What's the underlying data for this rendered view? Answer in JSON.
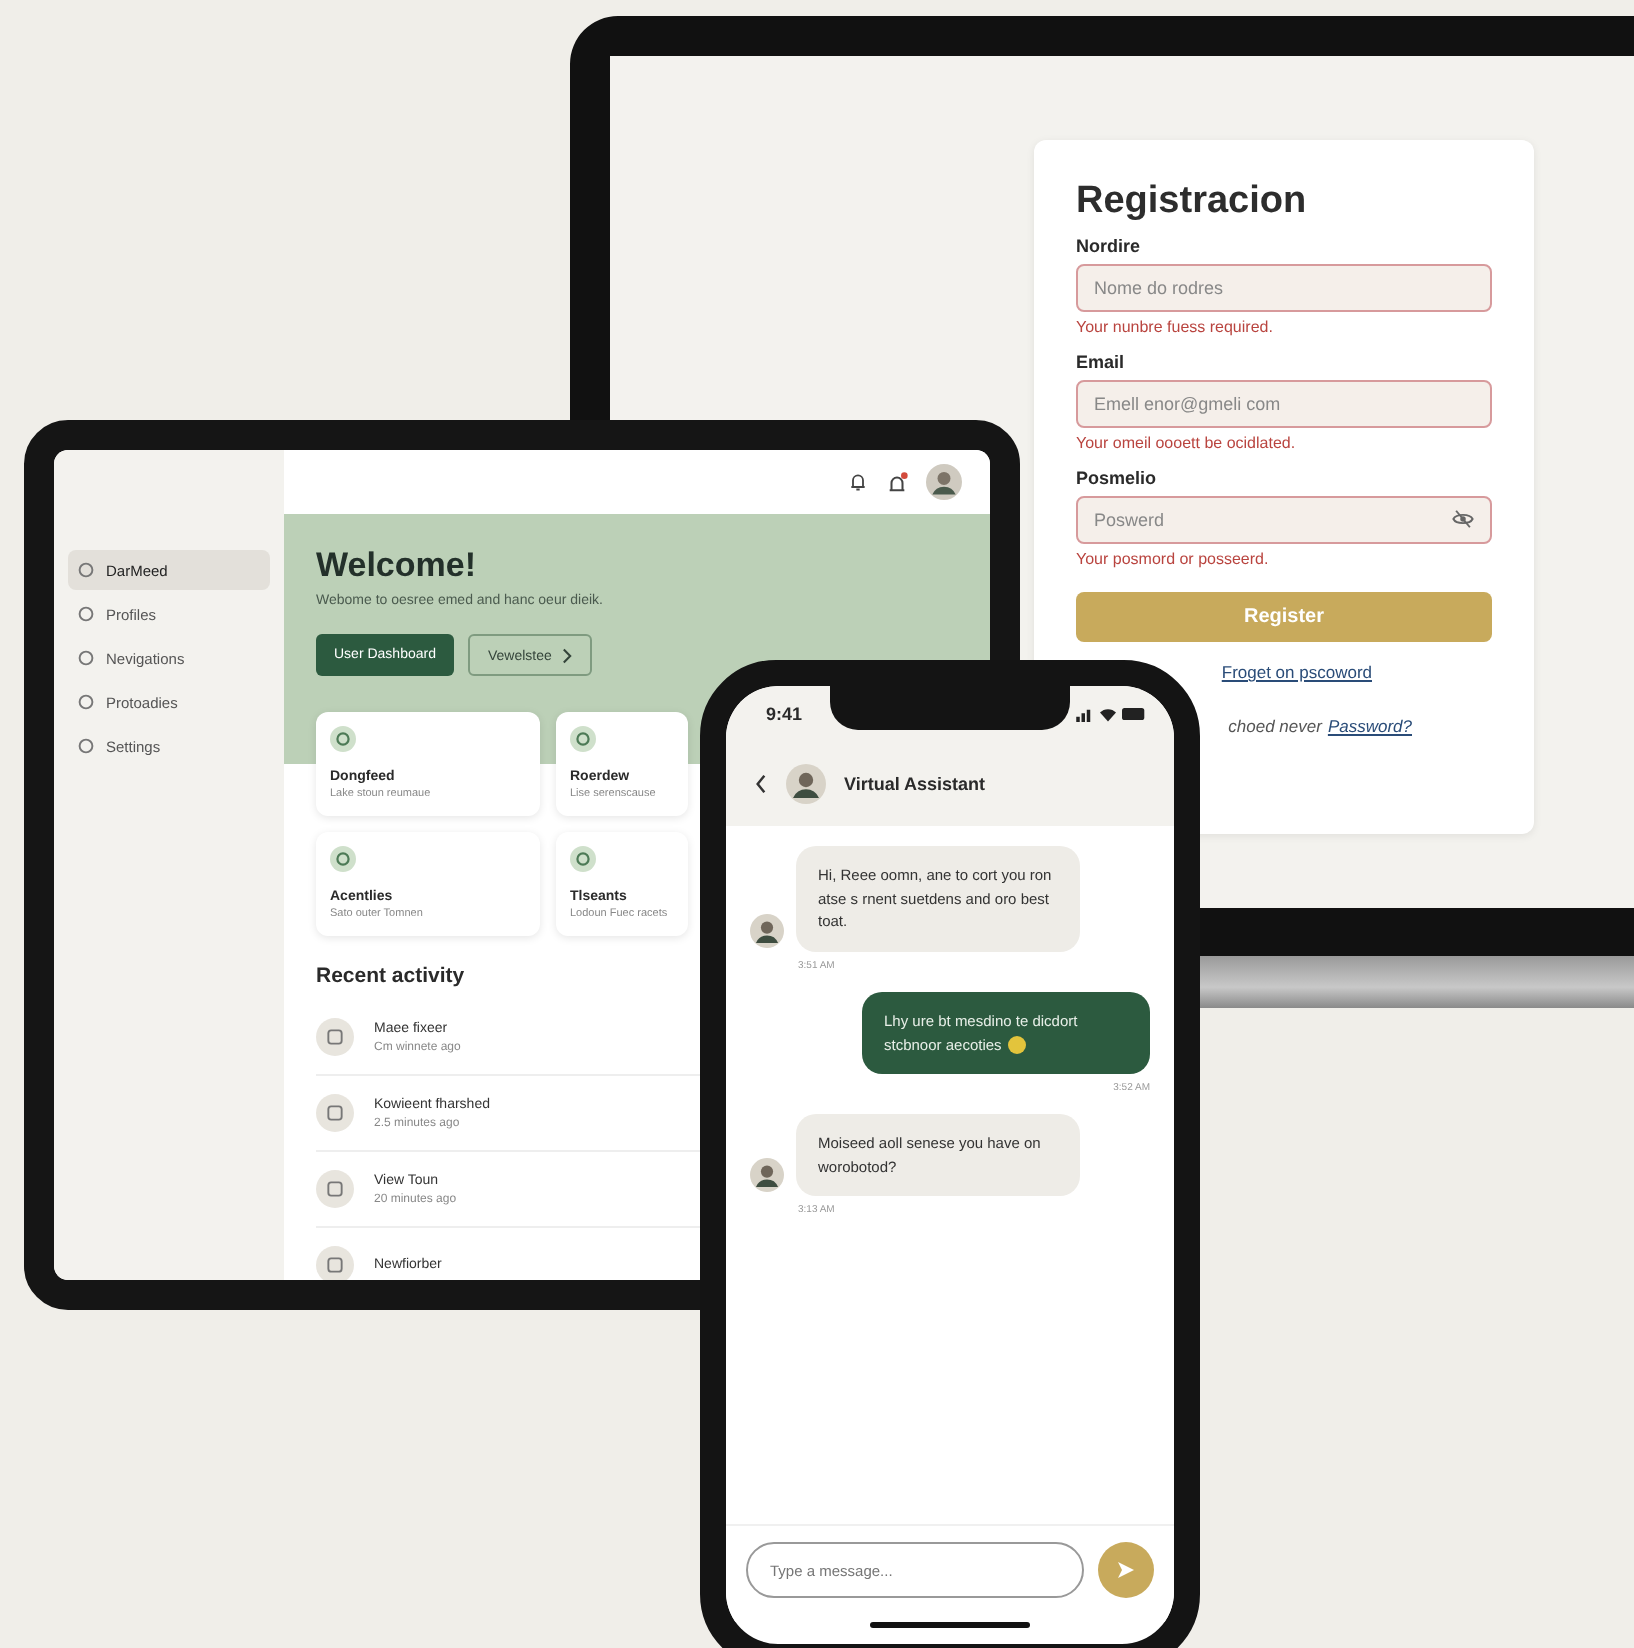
{
  "laptop": {
    "registration": {
      "title": "Registracion",
      "fields": [
        {
          "kind": "text",
          "label": "Nordire",
          "placeholder": "Nome do rodres",
          "error": "Your nunbre fuess required."
        },
        {
          "kind": "text",
          "label": "Email",
          "placeholder": "Emell enor@gmeli com",
          "error": "Your omeil oooett be ocidlated."
        },
        {
          "kind": "password",
          "label": "Posmelio",
          "placeholder": "Poswerd",
          "error": "Your posmord or posseerd."
        }
      ],
      "register_button": "Register",
      "forgot_link": "Froget on pscoword",
      "footer_text": "choed never",
      "footer_link": "Password?"
    }
  },
  "tablet": {
    "sidebar": {
      "items": [
        {
          "label": "DarMeed",
          "selected": true
        },
        {
          "label": "Profiles",
          "selected": false
        },
        {
          "label": "Nevigations",
          "selected": false
        },
        {
          "label": "Protoadies",
          "selected": false
        },
        {
          "label": "Settings",
          "selected": false
        }
      ]
    },
    "hero": {
      "title": "Welcome!",
      "subtitle": "Webome to oesree emed and hanc oeur dieik.",
      "primary_button": "User Dashboard",
      "secondary_button": "Vewelstee"
    },
    "cards": [
      {
        "title": "Dongfeed",
        "subtitle": "Lake stoun reumaue"
      },
      {
        "title": "Roerdew",
        "subtitle": "Lise serenscause"
      },
      {
        "title": "Acentlies",
        "subtitle": "Sato outer Tomnen"
      },
      {
        "title": "Tlseants",
        "subtitle": "Lodoun Fuec racets"
      }
    ],
    "recent_activity": {
      "title": "Recent activity",
      "items": [
        {
          "title": "Maee fixeer",
          "time": "Cm winnete ago"
        },
        {
          "title": "Kowieent fharshed",
          "time": "2.5 minutes ago"
        },
        {
          "title": "View Toun",
          "time": "20 minutes ago"
        },
        {
          "title": "Newfiorber"
        }
      ]
    }
  },
  "phone": {
    "time": "9:41",
    "chat_title": "Virtual Assistant",
    "messages": [
      {
        "kind": "incoming",
        "text": "Hi, Reee oomn, ane to cort you ron atse s rnent suetdens and oro best toat.",
        "time": "3:51 AM"
      },
      {
        "kind": "outgoing",
        "text": "Lhy ure bt mesdino te dicdort stcbnoor aecoties",
        "time": "3:52 AM",
        "has_emoji": true
      },
      {
        "kind": "incoming",
        "text": "Moiseed aoll senese you have on worobotod?",
        "time": "3:13 AM"
      }
    ],
    "input_placeholder": "Type a message..."
  }
}
